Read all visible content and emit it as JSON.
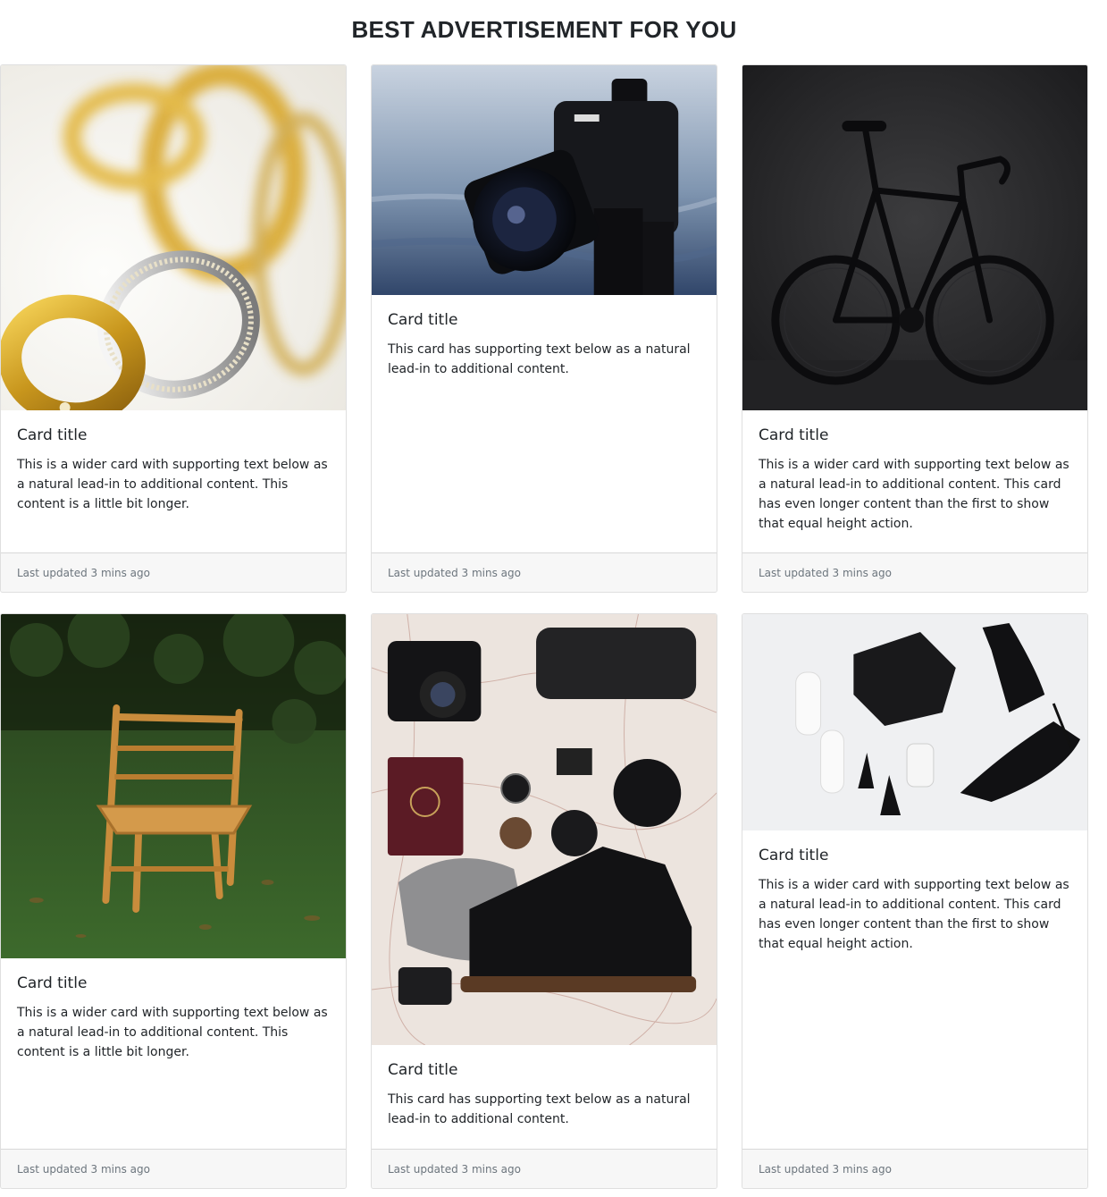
{
  "header": {
    "title": "BEST ADVERTISEMENT FOR YOU"
  },
  "cards": [
    {
      "title": "Card title",
      "text": "This is a wider card with supporting text below as a natural lead-in to additional content. This content is a little bit longer.",
      "footer": "Last updated 3 mins ago",
      "image": "gold-rings-photo"
    },
    {
      "title": "Card title",
      "text": "This card has supporting text below as a natural lead-in to additional content.",
      "footer": "Last updated 3 mins ago",
      "image": "camera-photo"
    },
    {
      "title": "Card title",
      "text": "This is a wider card with supporting text below as a natural lead-in to additional content. This card has even longer content than the first to show that equal height action.",
      "footer": "Last updated 3 mins ago",
      "image": "black-bicycle-photo"
    },
    {
      "title": "Card title",
      "text": "This is a wider card with supporting text below as a natural lead-in to additional content. This content is a little bit longer.",
      "footer": "Last updated 3 mins ago",
      "image": "wooden-chair-photo"
    },
    {
      "title": "Card title",
      "text": "This card has supporting text below as a natural lead-in to additional content.",
      "footer": "Last updated 3 mins ago",
      "image": "travel-flatlay-photo"
    },
    {
      "title": "Card title",
      "text": "This is a wider card with supporting text below as a natural lead-in to additional content. This card has even longer content than the first to show that equal height action.",
      "footer": "Last updated 3 mins ago",
      "image": "fashion-flatlay-photo"
    }
  ],
  "colors": {
    "footer_bg": "#f7f7f7",
    "border": "#dfdfdf",
    "muted_text": "#6c757d",
    "text": "#212529"
  }
}
